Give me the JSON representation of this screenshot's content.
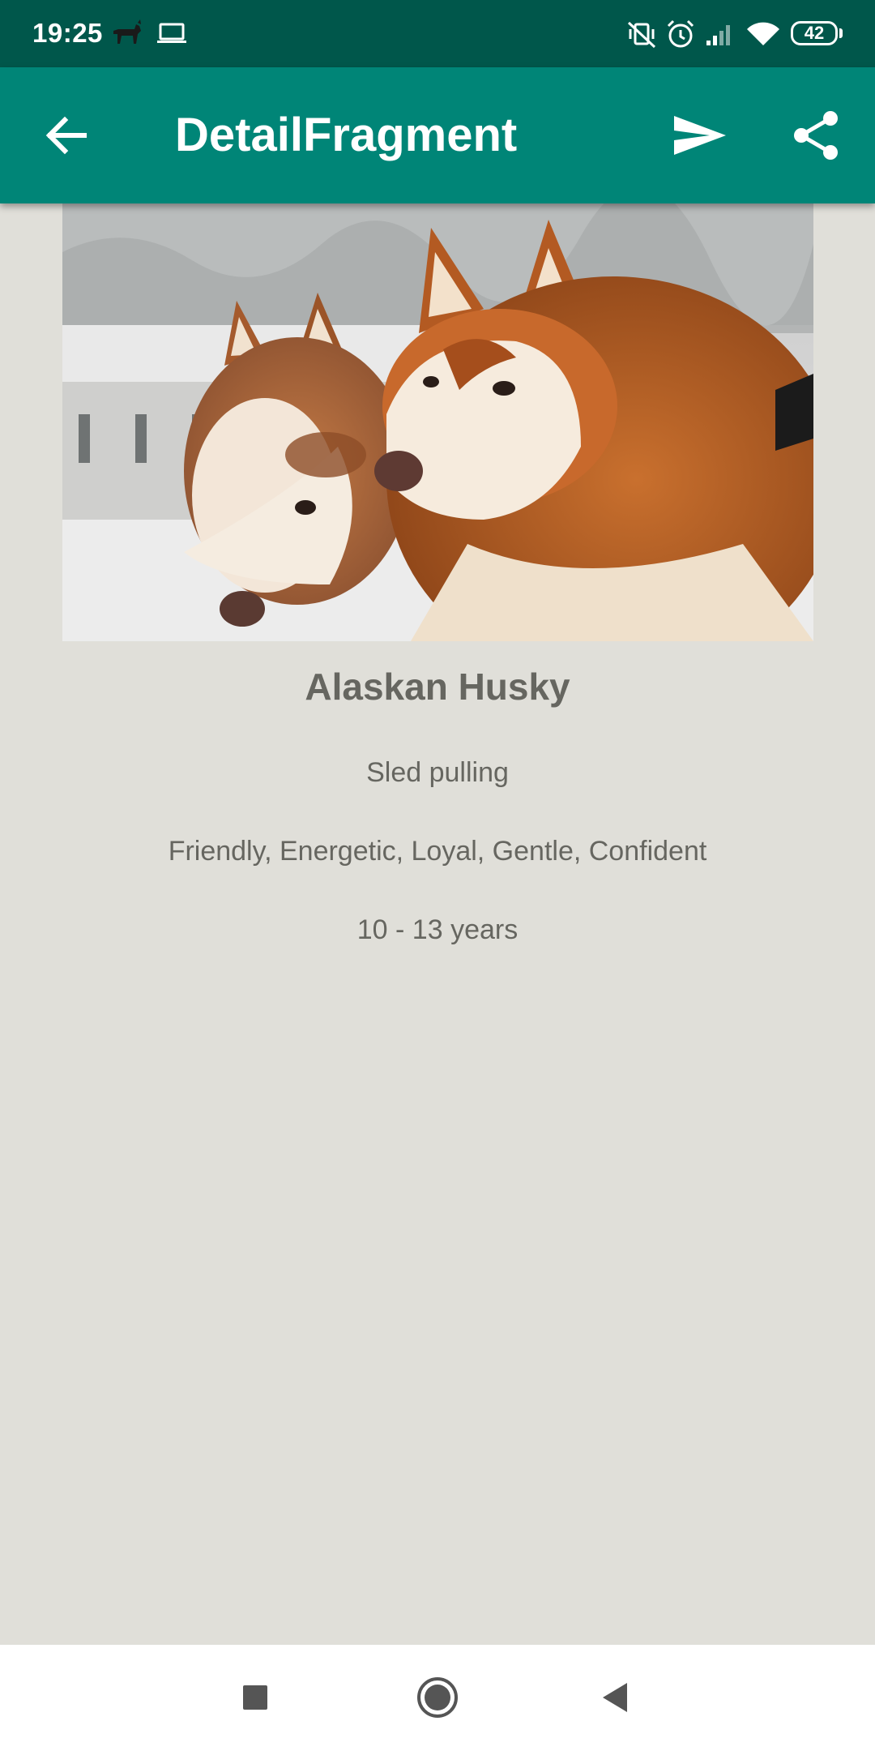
{
  "status_bar": {
    "time": "19:25",
    "battery": "42",
    "icons": [
      "dog-notification-icon",
      "laptop-icon",
      "vibrate-off-icon",
      "alarm-icon",
      "signal-icon",
      "wifi-icon",
      "battery-icon"
    ]
  },
  "app_bar": {
    "title": "DetailFragment",
    "icons": [
      "back-arrow-icon",
      "send-icon",
      "share-icon"
    ]
  },
  "detail": {
    "name": "Alaskan Husky",
    "bred_for": "Sled pulling",
    "temperament": "Friendly, Energetic, Loyal, Gentle, Confident",
    "life_span": "10 - 13 years"
  },
  "nav_bar": {
    "icons": [
      "recents-square-icon",
      "home-circle-icon",
      "back-triangle-icon"
    ]
  },
  "colors": {
    "status_bar": "#00574b",
    "app_bar": "#008577",
    "background": "#e0dfd9",
    "text": "#666660"
  }
}
